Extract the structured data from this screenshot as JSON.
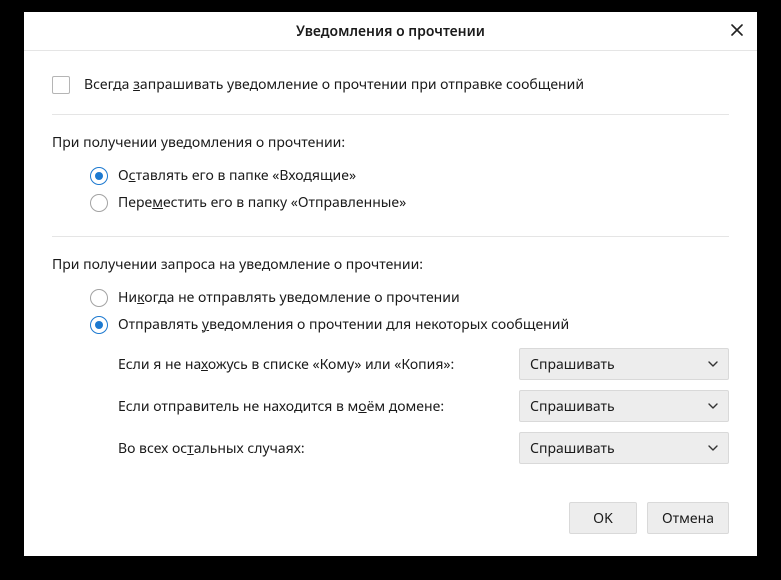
{
  "title": "Уведомления о прочтении",
  "checkbox": {
    "always_request": {
      "pre": "Всегда ",
      "mn": "з",
      "post": "апрашивать уведомление о прочтении при отправке сообщений",
      "checked": false
    }
  },
  "section1": {
    "label": "При получении уведомления о прочтении:",
    "radio_inbox": {
      "pre": "О",
      "mn": "с",
      "post": "тавлять его в папке «Входящие»",
      "checked": true
    },
    "radio_sent": {
      "pre": "Пере",
      "mn": "м",
      "post": "естить его в папку «Отправленные»",
      "checked": false
    }
  },
  "section2": {
    "label": "При получении запроса на уведомление о прочтении:",
    "radio_never": {
      "pre": "Ни",
      "mn": "к",
      "post": "огда не отправлять уведомление о прочтении",
      "checked": false
    },
    "radio_some": {
      "pre": "Отправлять ",
      "mn": "у",
      "post": "ведомления о прочтении для некоторых сообщений",
      "checked": true
    },
    "row_not_in_to": {
      "pre": "Если я не на",
      "mn": "х",
      "post": "ожусь в списке «Кому» или «Копия»:",
      "value": "Спрашивать"
    },
    "row_not_my_domain": {
      "pre": "Если отправитель не находится в м",
      "mn": "о",
      "post": "ём домене:",
      "value": "Спрашивать"
    },
    "row_other": {
      "pre": "Во всех ос",
      "mn": "т",
      "post": "альных случаях:",
      "value": "Спрашивать"
    }
  },
  "buttons": {
    "ok": "OK",
    "cancel": "Отмена"
  }
}
